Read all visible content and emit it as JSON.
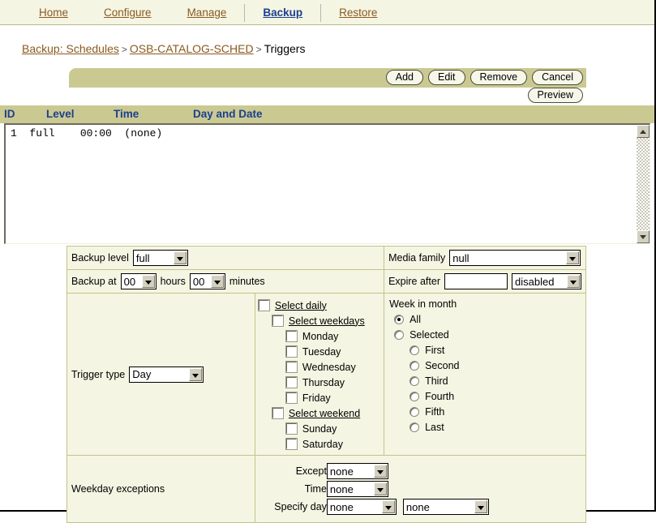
{
  "nav": {
    "items": [
      {
        "label": "Home",
        "active": false
      },
      {
        "label": "Configure",
        "active": false
      },
      {
        "label": "Manage",
        "active": false
      },
      {
        "label": "Backup",
        "active": true
      },
      {
        "label": "Restore",
        "active": false
      }
    ]
  },
  "breadcrumb": {
    "root": "Backup: Schedules",
    "sep1": ">",
    "schedule": "OSB-CATALOG-SCHED",
    "sep2": ">",
    "current": "Triggers"
  },
  "toolbar": {
    "add": "Add",
    "edit": "Edit",
    "remove": "Remove",
    "cancel": "Cancel",
    "preview": "Preview"
  },
  "triggers_table": {
    "columns": [
      "ID",
      "Level",
      "Time",
      "Day and Date"
    ],
    "rows": [
      {
        "text": "1  full    00:00  (none)"
      }
    ]
  },
  "form": {
    "backup_level_label": "Backup level",
    "backup_level_value": "full",
    "media_family_label": "Media family",
    "media_family_value": "null",
    "backup_at_label": "Backup at",
    "backup_at_hours_value": "00",
    "hours_label": "hours",
    "backup_at_minutes_value": "00",
    "minutes_label": "minutes",
    "expire_after_label": "Expire after",
    "expire_after_value": "",
    "expire_after_placeholder": "",
    "expire_after_unit_value": "disabled",
    "trigger_type_label": "Trigger type",
    "trigger_type_value": "Day",
    "day_options": [
      {
        "label": "Select daily",
        "indent": 0,
        "underline": true,
        "checked": false
      },
      {
        "label": "Select weekdays",
        "indent": 1,
        "underline": true,
        "checked": false
      },
      {
        "label": "Monday",
        "indent": 2,
        "underline": false,
        "checked": false
      },
      {
        "label": "Tuesday",
        "indent": 2,
        "underline": false,
        "checked": false
      },
      {
        "label": "Wednesday",
        "indent": 2,
        "underline": false,
        "checked": false
      },
      {
        "label": "Thursday",
        "indent": 2,
        "underline": false,
        "checked": false
      },
      {
        "label": "Friday",
        "indent": 2,
        "underline": false,
        "checked": false
      },
      {
        "label": "Select weekend",
        "indent": 1,
        "underline": true,
        "checked": false
      },
      {
        "label": "Sunday",
        "indent": 2,
        "underline": false,
        "checked": false
      },
      {
        "label": "Saturday",
        "indent": 2,
        "underline": false,
        "checked": false
      }
    ],
    "week_in_month_label": "Week in month",
    "week_options": [
      {
        "label": "All",
        "indent": 0,
        "checked": true
      },
      {
        "label": "Selected",
        "indent": 0,
        "checked": false
      },
      {
        "label": "First",
        "indent": 1,
        "checked": false
      },
      {
        "label": "Second",
        "indent": 1,
        "checked": false
      },
      {
        "label": "Third",
        "indent": 1,
        "checked": false
      },
      {
        "label": "Fourth",
        "indent": 1,
        "checked": false
      },
      {
        "label": "Fifth",
        "indent": 1,
        "checked": false
      },
      {
        "label": "Last",
        "indent": 1,
        "checked": false
      }
    ],
    "weekday_exceptions_label": "Weekday exceptions",
    "except_label": "Except",
    "except_value": "none",
    "time_label": "Time",
    "time_value": "none",
    "specify_day_label": "Specify day",
    "specify_day_value": "none",
    "specify_day_value2": "none"
  },
  "colors": {
    "nav_bg": "#f5f5e3",
    "link": "#8a5a20",
    "active_link": "#1b3f8f",
    "toolbar_bg": "#cbc992",
    "header_bg": "#cbc992",
    "panel_bg": "#f5f5e3",
    "border": "#c3c388"
  }
}
